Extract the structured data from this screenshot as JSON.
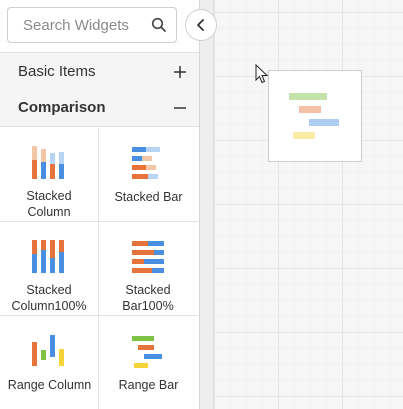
{
  "search": {
    "placeholder": "Search Widgets",
    "icon": "search-icon"
  },
  "sections": [
    {
      "label": "Basic Items",
      "toggle_icon": "plus-icon",
      "expanded": false
    },
    {
      "label": "Comparison",
      "toggle_icon": "minus-icon",
      "expanded": true
    }
  ],
  "widgets": [
    {
      "label": "Stacked Column",
      "icon": "stacked-column-icon"
    },
    {
      "label": "Stacked Bar",
      "icon": "stacked-bar-icon"
    },
    {
      "label": "Stacked Column100%",
      "icon": "stacked-column100-icon"
    },
    {
      "label": "Stacked Bar100%",
      "icon": "stacked-bar100-icon"
    },
    {
      "label": "Range Column",
      "icon": "range-column-icon"
    },
    {
      "label": "Range Bar",
      "icon": "range-bar-icon"
    }
  ],
  "panel_toggle": {
    "icon": "chevron-left-icon"
  },
  "colors": {
    "blue": "#4a90e2",
    "orange": "#e8743b",
    "light_blue": "#b7d4f3",
    "light_orange": "#f3c6a8",
    "green": "#7dc242",
    "yellow": "#f5d33a"
  }
}
